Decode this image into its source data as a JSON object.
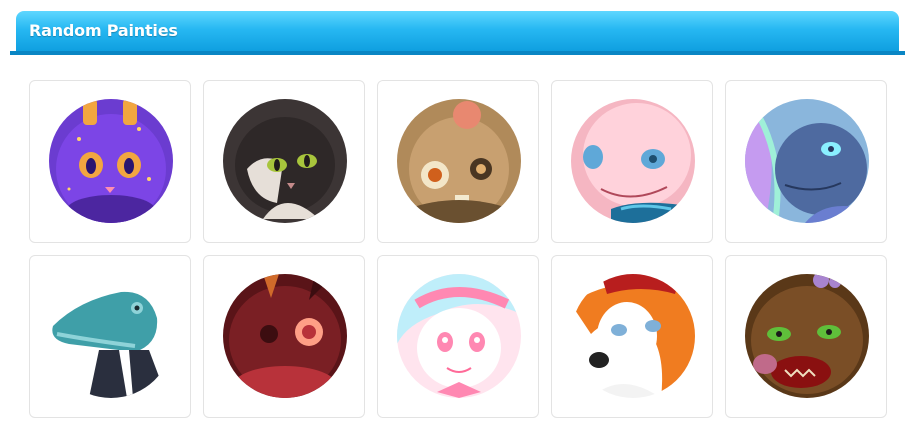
{
  "header": {
    "title": "Random Painties",
    "accent": "#1eb0ef"
  },
  "painties": [
    {
      "name": "purple-horned-cat",
      "palette": [
        "#5b2fb8",
        "#8a4ff0",
        "#f2a640",
        "#2a1570"
      ]
    },
    {
      "name": "black-white-cat",
      "palette": [
        "#3c3535",
        "#e6dfd8",
        "#a8c53c",
        "#201b1b"
      ]
    },
    {
      "name": "zombie-rabbit",
      "palette": [
        "#8a6b3e",
        "#c8a070",
        "#e88870",
        "#4a3622"
      ]
    },
    {
      "name": "pink-creature",
      "palette": [
        "#f5b6c2",
        "#ffd2db",
        "#5fa8d8",
        "#1d6f9a"
      ]
    },
    {
      "name": "blue-dragon",
      "palette": [
        "#4e6aa0",
        "#8ab6dc",
        "#c59bf0",
        "#26385e"
      ]
    },
    {
      "name": "teal-crocodile",
      "palette": [
        "#3f9fa8",
        "#8ed3d8",
        "#2a2f3e",
        "#ffffff"
      ]
    },
    {
      "name": "red-creature",
      "palette": [
        "#7a1f24",
        "#b8323a",
        "#ff9f86",
        "#3c0d10"
      ]
    },
    {
      "name": "pastel-unicorn",
      "palette": [
        "#ffd0e0",
        "#bfeefa",
        "#ff88b2",
        "#ffffff"
      ]
    },
    {
      "name": "orange-white-dog",
      "palette": [
        "#f07c20",
        "#ffffff",
        "#7fb0d8",
        "#222222"
      ]
    },
    {
      "name": "brown-zombie-bear",
      "palette": [
        "#7a4e26",
        "#b07a3e",
        "#5fbf3a",
        "#8a1010"
      ]
    }
  ]
}
